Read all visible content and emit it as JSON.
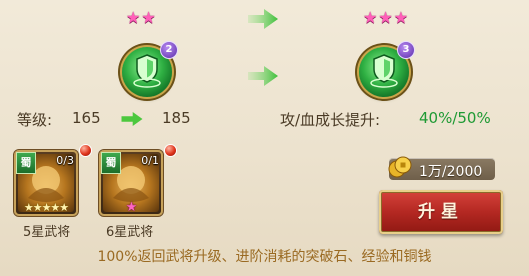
{
  "star_upgrade": {
    "current_stars": 2,
    "next_stars": 3,
    "current_level_badge": "2",
    "next_level_badge": "3",
    "level_label": "等级:",
    "level_from": "165",
    "level_to": "185",
    "growth_label": "攻/血成长提升:",
    "growth_value": "40%/50%"
  },
  "materials": [
    {
      "kingdom": "蜀",
      "count": "0/3",
      "stars": 5,
      "star_type": "gold",
      "label": "5星武将"
    },
    {
      "kingdom": "蜀",
      "count": "0/1",
      "stars": 1,
      "star_type": "pink",
      "label": "6星武将"
    }
  ],
  "cost": {
    "icon": "copper-coin-icon",
    "text": "1万/2000"
  },
  "upgrade_button": {
    "label": "升星"
  },
  "footer_note": "100%返回武将升级、进阶消耗的突破石、经验和铜钱",
  "colors": {
    "green_text": "#1f9a34",
    "pink_star": "#ff5fb8",
    "button_red": "#b42822"
  }
}
